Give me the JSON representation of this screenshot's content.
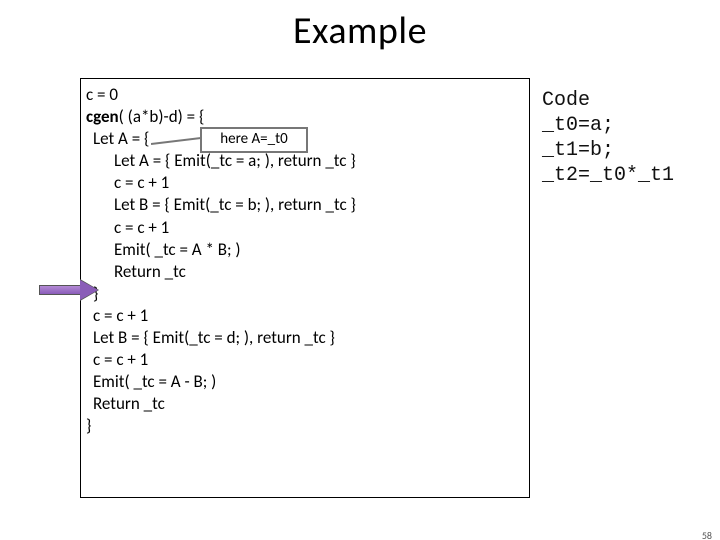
{
  "title": "Example",
  "label_box": "here A=_t0",
  "pseudo": {
    "l0": "c = 0",
    "l1_a": "cgen",
    "l1_b": "( (a*b)-d) = {",
    "l2": "Let A = {",
    "l3": "Let A = { Emit(_tc = a; ), return _tc }",
    "l4": "c = c + 1",
    "l5": "Let B = { Emit(_tc = b; ), return _tc }",
    "l6": "c = c + 1",
    "l7": "Emit( _tc = A * B; )",
    "l8": "Return _tc",
    "l9": "}",
    "l10": "c = c + 1",
    "l11": "Let B = { Emit(_tc = d; ), return _tc }",
    "l12": "c = c + 1",
    "l13": "Emit( _tc = A - B; )",
    "l14": "Return _tc",
    "l15": "}"
  },
  "emitted": {
    "h": "Code",
    "r0": "_t0=a;",
    "r1": "_t1=b;",
    "r2": "_t2=_t0*_t1"
  },
  "page_number": "58"
}
